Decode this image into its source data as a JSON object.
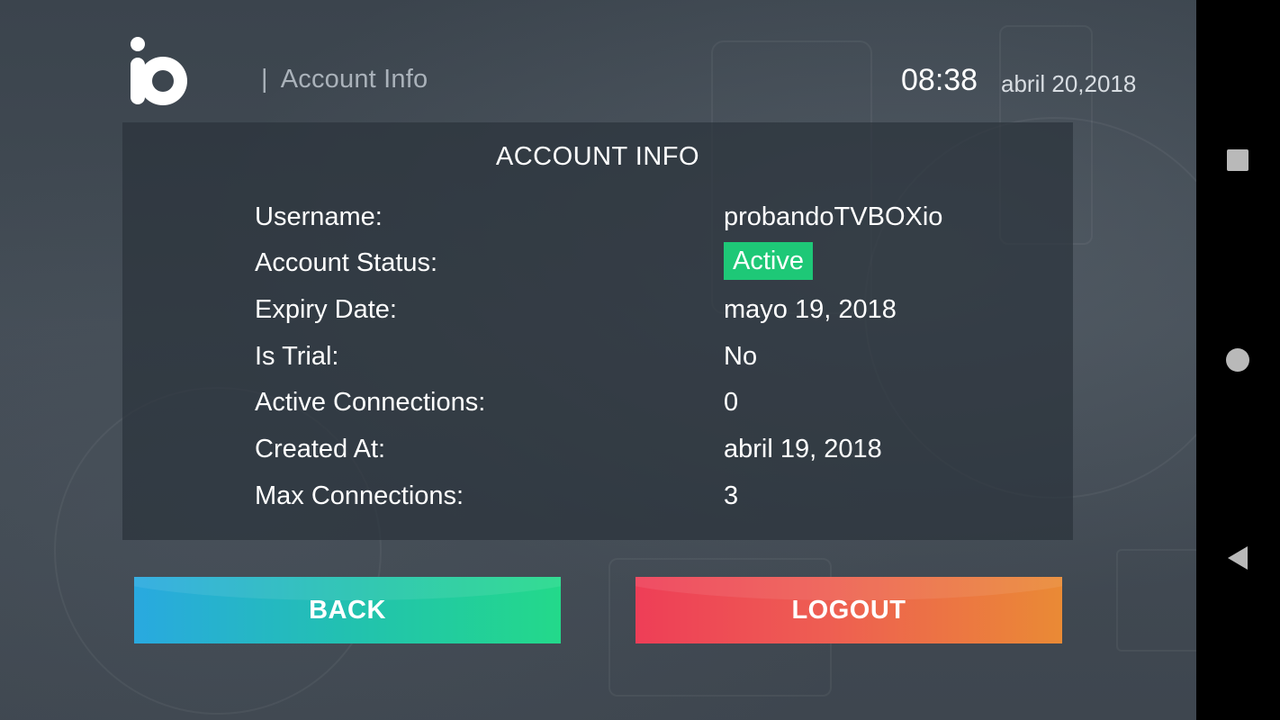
{
  "header": {
    "separator": "|",
    "title": "Account Info",
    "time": "08:38",
    "date": "abril 20,2018"
  },
  "panel": {
    "title": "ACCOUNT INFO",
    "rows": [
      {
        "label": "Username:",
        "value": "probandoTVBOXio"
      },
      {
        "label": "Account Status:",
        "value": "Active"
      },
      {
        "label": "Expiry Date:",
        "value": "mayo 19, 2018"
      },
      {
        "label": "Is Trial:",
        "value": "No"
      },
      {
        "label": "Active Connections:",
        "value": "0"
      },
      {
        "label": "Created At:",
        "value": "abril 19, 2018"
      },
      {
        "label": "Max Connections:",
        "value": "3"
      }
    ]
  },
  "buttons": {
    "back": "BACK",
    "logout": "LOGOUT"
  },
  "colors": {
    "status_active": "#1ec877",
    "back_gradient_start": "#29a9e0",
    "back_gradient_end": "#23d98a",
    "logout_gradient_start": "#ee3e57",
    "logout_gradient_end": "#ea8a35"
  },
  "icons": {
    "logo": "io-logo",
    "nav_recents": "square-icon",
    "nav_home": "circle-icon",
    "nav_back": "back-triangle-icon"
  }
}
